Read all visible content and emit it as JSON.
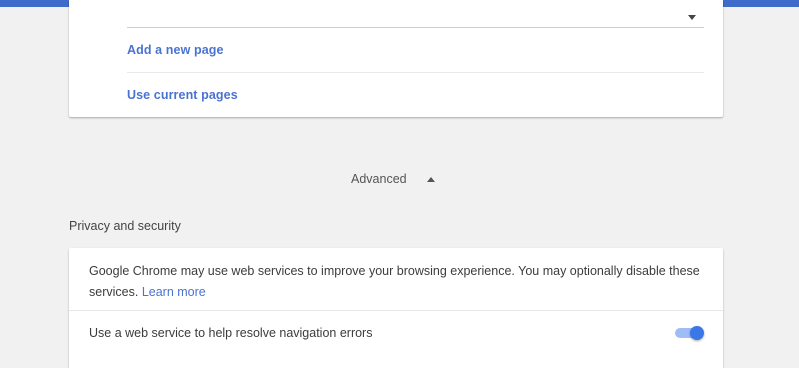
{
  "colors": {
    "accent": "#3f6ccb",
    "link": "#4a73d1",
    "toggle_on": "#3b78e7",
    "background": "#f1f1f1"
  },
  "startup": {
    "add_new_page": "Add a new page",
    "use_current_pages": "Use current pages",
    "dropdown_icon": "chevron-down-icon"
  },
  "advanced": {
    "label": "Advanced",
    "icon": "chevron-up-icon",
    "expanded": true
  },
  "privacy": {
    "title": "Privacy and security",
    "description": "Google Chrome may use web services to improve your browsing experience. You may optionally disable these services.",
    "learn_more": "Learn more",
    "nav_errors_label": "Use a web service to help resolve navigation errors",
    "nav_errors_enabled": true
  }
}
